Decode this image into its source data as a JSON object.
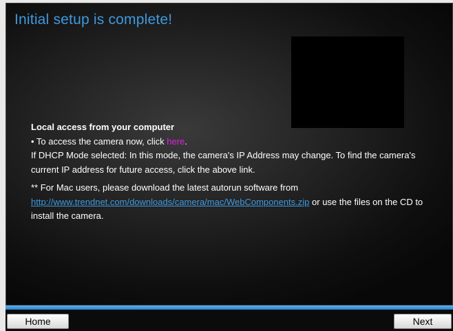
{
  "header": {
    "title": "Initial setup is complete!"
  },
  "local_access": {
    "heading": "Local access from your computer",
    "access_prefix": "• To access the camera now, click ",
    "access_link": "here",
    "access_suffix": ".",
    "dhcp_text": "If DHCP Mode selected: In this mode, the camera's IP Address may change. To find the camera's current IP address for future access, click the above link.",
    "mac_prefix": "** For Mac users, please download the latest autorun software from",
    "mac_link": "http://www.trendnet.com/downloads/camera/mac/WebComponents.zip",
    "mac_suffix": " or use the files on the CD to install the camera."
  },
  "footer": {
    "home_label": "Home",
    "next_label": "Next"
  },
  "colors": {
    "title": "#3d9ae0",
    "link_here": "#e020e0",
    "link_mac": "#3d9ae0",
    "stripe": "#3a9ae0"
  }
}
